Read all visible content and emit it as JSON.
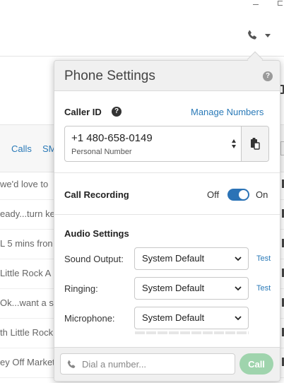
{
  "background": {
    "tabs": [
      "Calls",
      "SM"
    ],
    "rows": [
      "we'd love to",
      "eady...turn ke",
      "L 5 mins fron",
      " Little Rock A",
      "Ok...want a se",
      "th Little Rock",
      "ey Off Market"
    ]
  },
  "phone_settings": {
    "title": "Phone Settings",
    "help_glyph": "?",
    "caller_id": {
      "label": "Caller ID",
      "info_glyph": "?",
      "manage_link": "Manage Numbers",
      "number": "+1 480-658-0149",
      "number_type": "Personal Number"
    },
    "call_recording": {
      "label": "Call Recording",
      "off_label": "Off",
      "on_label": "On",
      "state": "on"
    },
    "audio_settings": {
      "label": "Audio Settings",
      "sound_output": {
        "label": "Sound Output:",
        "value": "System Default",
        "test": "Test"
      },
      "ringing": {
        "label": "Ringing:",
        "value": "System Default",
        "test": "Test"
      },
      "microphone": {
        "label": "Microphone:",
        "value": "System Default"
      }
    },
    "dialer": {
      "placeholder": "Dial a number...",
      "call_label": "Call"
    }
  },
  "colors": {
    "accent": "#2a7ab8",
    "toggle_on": "#2b73b6",
    "call_button": "#9fd4ad"
  },
  "icons": [
    "phone-icon",
    "clipboard-icon",
    "chevron-down-icon",
    "help-icon",
    "info-icon",
    "calendar-icon"
  ]
}
